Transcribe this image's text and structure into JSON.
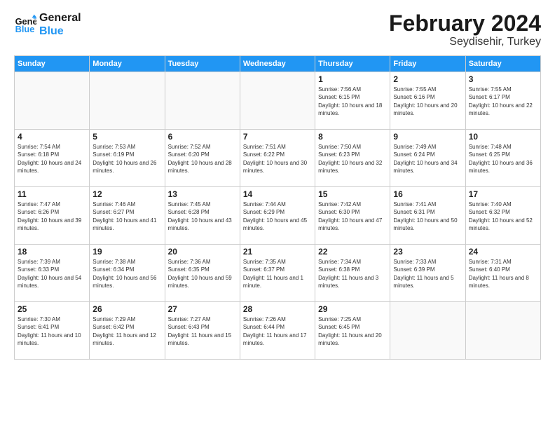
{
  "logo": {
    "line1": "General",
    "line2": "Blue"
  },
  "title": "February 2024",
  "location": "Seydisehir, Turkey",
  "days_of_week": [
    "Sunday",
    "Monday",
    "Tuesday",
    "Wednesday",
    "Thursday",
    "Friday",
    "Saturday"
  ],
  "weeks": [
    [
      {
        "day": "",
        "empty": true
      },
      {
        "day": "",
        "empty": true
      },
      {
        "day": "",
        "empty": true
      },
      {
        "day": "",
        "empty": true
      },
      {
        "day": "1",
        "sunrise": "7:56 AM",
        "sunset": "6:15 PM",
        "daylight": "10 hours and 18 minutes."
      },
      {
        "day": "2",
        "sunrise": "7:55 AM",
        "sunset": "6:16 PM",
        "daylight": "10 hours and 20 minutes."
      },
      {
        "day": "3",
        "sunrise": "7:55 AM",
        "sunset": "6:17 PM",
        "daylight": "10 hours and 22 minutes."
      }
    ],
    [
      {
        "day": "4",
        "sunrise": "7:54 AM",
        "sunset": "6:18 PM",
        "daylight": "10 hours and 24 minutes."
      },
      {
        "day": "5",
        "sunrise": "7:53 AM",
        "sunset": "6:19 PM",
        "daylight": "10 hours and 26 minutes."
      },
      {
        "day": "6",
        "sunrise": "7:52 AM",
        "sunset": "6:20 PM",
        "daylight": "10 hours and 28 minutes."
      },
      {
        "day": "7",
        "sunrise": "7:51 AM",
        "sunset": "6:22 PM",
        "daylight": "10 hours and 30 minutes."
      },
      {
        "day": "8",
        "sunrise": "7:50 AM",
        "sunset": "6:23 PM",
        "daylight": "10 hours and 32 minutes."
      },
      {
        "day": "9",
        "sunrise": "7:49 AM",
        "sunset": "6:24 PM",
        "daylight": "10 hours and 34 minutes."
      },
      {
        "day": "10",
        "sunrise": "7:48 AM",
        "sunset": "6:25 PM",
        "daylight": "10 hours and 36 minutes."
      }
    ],
    [
      {
        "day": "11",
        "sunrise": "7:47 AM",
        "sunset": "6:26 PM",
        "daylight": "10 hours and 39 minutes."
      },
      {
        "day": "12",
        "sunrise": "7:46 AM",
        "sunset": "6:27 PM",
        "daylight": "10 hours and 41 minutes."
      },
      {
        "day": "13",
        "sunrise": "7:45 AM",
        "sunset": "6:28 PM",
        "daylight": "10 hours and 43 minutes."
      },
      {
        "day": "14",
        "sunrise": "7:44 AM",
        "sunset": "6:29 PM",
        "daylight": "10 hours and 45 minutes."
      },
      {
        "day": "15",
        "sunrise": "7:42 AM",
        "sunset": "6:30 PM",
        "daylight": "10 hours and 47 minutes."
      },
      {
        "day": "16",
        "sunrise": "7:41 AM",
        "sunset": "6:31 PM",
        "daylight": "10 hours and 50 minutes."
      },
      {
        "day": "17",
        "sunrise": "7:40 AM",
        "sunset": "6:32 PM",
        "daylight": "10 hours and 52 minutes."
      }
    ],
    [
      {
        "day": "18",
        "sunrise": "7:39 AM",
        "sunset": "6:33 PM",
        "daylight": "10 hours and 54 minutes."
      },
      {
        "day": "19",
        "sunrise": "7:38 AM",
        "sunset": "6:34 PM",
        "daylight": "10 hours and 56 minutes."
      },
      {
        "day": "20",
        "sunrise": "7:36 AM",
        "sunset": "6:35 PM",
        "daylight": "10 hours and 59 minutes."
      },
      {
        "day": "21",
        "sunrise": "7:35 AM",
        "sunset": "6:37 PM",
        "daylight": "11 hours and 1 minute."
      },
      {
        "day": "22",
        "sunrise": "7:34 AM",
        "sunset": "6:38 PM",
        "daylight": "11 hours and 3 minutes."
      },
      {
        "day": "23",
        "sunrise": "7:33 AM",
        "sunset": "6:39 PM",
        "daylight": "11 hours and 5 minutes."
      },
      {
        "day": "24",
        "sunrise": "7:31 AM",
        "sunset": "6:40 PM",
        "daylight": "11 hours and 8 minutes."
      }
    ],
    [
      {
        "day": "25",
        "sunrise": "7:30 AM",
        "sunset": "6:41 PM",
        "daylight": "11 hours and 10 minutes."
      },
      {
        "day": "26",
        "sunrise": "7:29 AM",
        "sunset": "6:42 PM",
        "daylight": "11 hours and 12 minutes."
      },
      {
        "day": "27",
        "sunrise": "7:27 AM",
        "sunset": "6:43 PM",
        "daylight": "11 hours and 15 minutes."
      },
      {
        "day": "28",
        "sunrise": "7:26 AM",
        "sunset": "6:44 PM",
        "daylight": "11 hours and 17 minutes."
      },
      {
        "day": "29",
        "sunrise": "7:25 AM",
        "sunset": "6:45 PM",
        "daylight": "11 hours and 20 minutes."
      },
      {
        "day": "",
        "empty": true
      },
      {
        "day": "",
        "empty": true
      }
    ]
  ]
}
